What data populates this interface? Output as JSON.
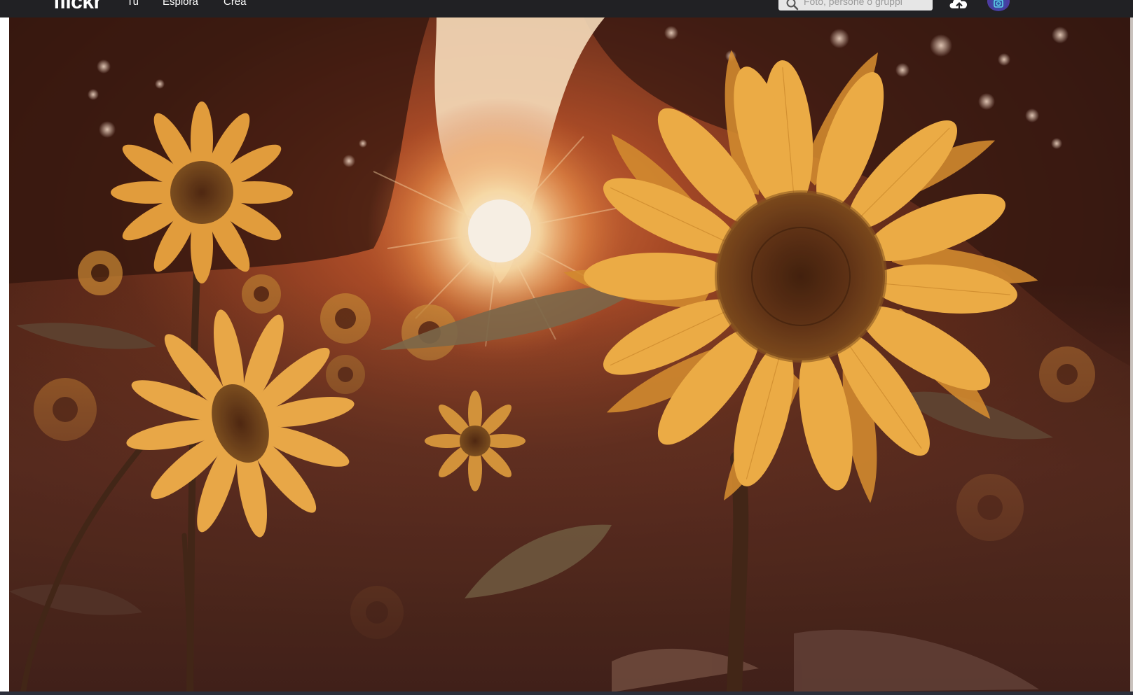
{
  "header": {
    "logo_text": "flickr",
    "nav": [
      {
        "label": "Tu"
      },
      {
        "label": "Esplora"
      },
      {
        "label": "Crea"
      }
    ],
    "search": {
      "placeholder": "Foto, persone o gruppi",
      "value": ""
    },
    "icons": {
      "search": "search-icon",
      "upload": "upload-cloud-icon",
      "avatar": "avatar"
    }
  },
  "photo": {
    "subject": "sunflower-field-at-sunset",
    "colors": {
      "background": "#2a1410",
      "petal": "#f4b548",
      "petal_dark": "#d78f2c",
      "seed_disc": "#5a2e12",
      "sun": "#fff6dc",
      "leaf": "#6a5a44"
    }
  },
  "colors": {
    "topbar_bg": "#212124",
    "nav_text": "#ffffff",
    "search_bg": "#e6e6e6"
  }
}
